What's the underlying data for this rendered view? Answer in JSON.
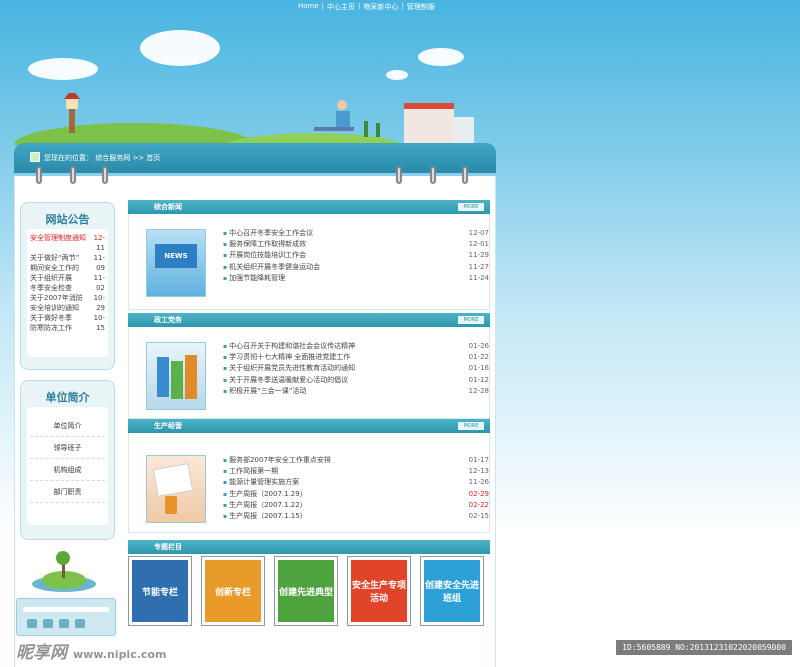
{
  "topnav": {
    "items": [
      "Home",
      "中心主页",
      "物采新中心",
      "管理制服"
    ]
  },
  "crumb": {
    "text": "您现在的位置： 综合服务网 >> 首页"
  },
  "notice": {
    "title": "网站公告",
    "items": [
      {
        "text": "安全管理制度通知",
        "date": "12-",
        "red": true
      },
      {
        "text": "",
        "date": "11"
      },
      {
        "text": "关于做好“两节”",
        "date": "11-"
      },
      {
        "text": "期间安全工作的",
        "date": "09"
      },
      {
        "text": "关于组织开展",
        "date": "11-"
      },
      {
        "text": "冬季安全检查",
        "date": "02"
      },
      {
        "text": "关于2007年消防",
        "date": "10-"
      },
      {
        "text": "安全培训的通知",
        "date": "29"
      },
      {
        "text": "关于做好冬季",
        "date": "10-"
      },
      {
        "text": "防寒防冻工作",
        "date": "15"
      }
    ]
  },
  "units": {
    "title": "单位简介",
    "items": [
      "单位简介",
      "领导班子",
      "机构组成",
      "部门职责"
    ]
  },
  "sections": [
    {
      "title": "综合新闻",
      "more": "MORE",
      "thumb_label": "NEWS",
      "rows": [
        {
          "text": "中心召开冬季安全工作会议",
          "date": "12-07"
        },
        {
          "text": "服务保障工作取得新成效",
          "date": "12-01"
        },
        {
          "text": "开展岗位技能培训工作会",
          "date": "11-29"
        },
        {
          "text": "机关组织开展冬季健身运动会",
          "date": "11-27"
        },
        {
          "text": "加强节能降耗管理",
          "date": "11-24"
        }
      ]
    },
    {
      "title": "政工党务",
      "more": "MORE",
      "thumb_label": "",
      "rows": [
        {
          "text": "中心召开关于构建和谐社会会议传达精神",
          "date": "01-26"
        },
        {
          "text": "学习贯彻十七大精神 全面推进党建工作",
          "date": "01-22"
        },
        {
          "text": "关于组织开展党员先进性教育活动的通知",
          "date": "01-16"
        },
        {
          "text": "关于开展冬季送温暖献爱心活动的倡议",
          "date": "01-12"
        },
        {
          "text": "积极开展“三会一课”活动",
          "date": "12-28"
        }
      ]
    },
    {
      "title": "生产经营",
      "more": "MORE",
      "thumb_label": "",
      "rows": [
        {
          "text": "服务部2007年安全工作重点安排",
          "date": "01-17",
          "red": false
        },
        {
          "text": "工作简报第一期",
          "date": "12-13",
          "red": false
        },
        {
          "text": "能源计量管理实施方案",
          "date": "11-26",
          "red": false
        },
        {
          "text": "生产周报（2007.1.29）",
          "date": "02-29",
          "red": true
        },
        {
          "text": "生产周报（2007.1.22）",
          "date": "02-22",
          "red": true
        },
        {
          "text": "生产周报（2007.1.15）",
          "date": "02-15",
          "red": false
        }
      ]
    }
  ],
  "specials": {
    "title": "专题栏目",
    "tiles": [
      {
        "label": "节能专栏",
        "color": "#2f6fb0"
      },
      {
        "label": "创新专栏",
        "color": "#e89a2a"
      },
      {
        "label": "创建先进典型",
        "color": "#4fa33e"
      },
      {
        "label": "安全生产专项活动",
        "color": "#e0452a"
      },
      {
        "label": "创建安全先进班组",
        "color": "#2da0d8"
      }
    ]
  },
  "watermark": {
    "brand": "昵享网",
    "url": "www.nipic.com",
    "id": "ID:5605889 NO:20131231022020059000"
  },
  "colors": {
    "accent": "#2f97ad",
    "sky": "#47b4e0"
  }
}
